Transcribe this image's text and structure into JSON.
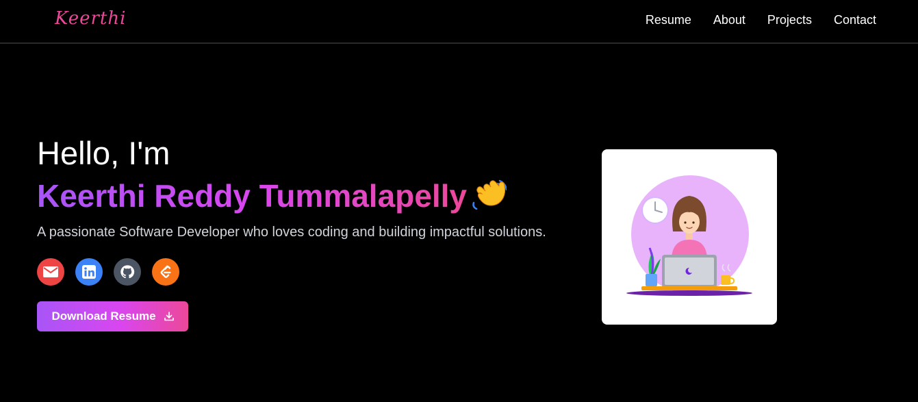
{
  "navbar": {
    "logo": "Keerthi",
    "links": [
      "Resume",
      "About",
      "Projects",
      "Contact"
    ]
  },
  "hero": {
    "greeting": "Hello, I'm",
    "name": "Keerthi Reddy Tummalapelly",
    "tagline": "A passionate Software Developer who loves coding and building impactful solutions.",
    "download_label": "Download Resume",
    "wave_icon": "waving-hand-icon"
  },
  "socials": [
    {
      "icon": "email-icon",
      "color": "#ef4444"
    },
    {
      "icon": "linkedin-icon",
      "color": "#3b82f6"
    },
    {
      "icon": "github-icon",
      "color": "#4b5563"
    },
    {
      "icon": "leetcode-icon",
      "color": "#f97316"
    }
  ],
  "colors": {
    "background": "#000000",
    "accent_purple": "#a855f7",
    "accent_pink": "#ec4899"
  },
  "illustration": {
    "icon": "developer-at-laptop-illustration"
  }
}
